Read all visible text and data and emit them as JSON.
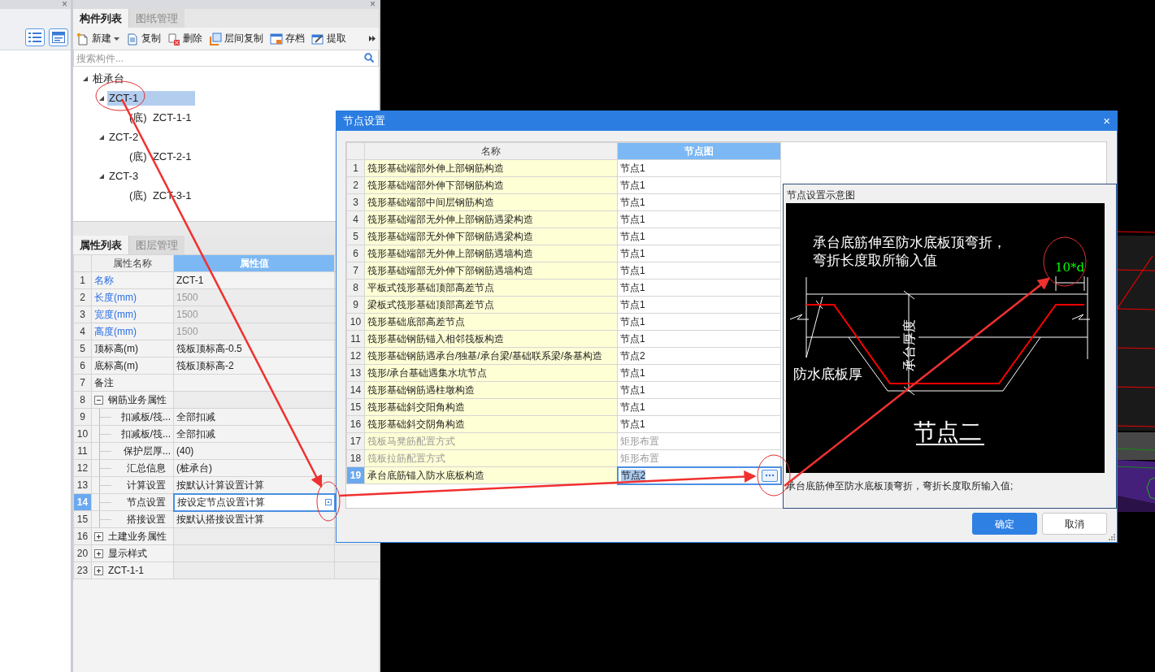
{
  "left_panel": {
    "close": "×"
  },
  "component_panel": {
    "close": "×",
    "tabs": [
      {
        "label": "构件列表",
        "selected": true
      },
      {
        "label": "图纸管理",
        "selected": false
      }
    ],
    "toolbar": [
      {
        "label": "新建",
        "kind": "new",
        "dropdown": true
      },
      {
        "label": "复制",
        "kind": "copy",
        "dropdown": false
      },
      {
        "label": "删除",
        "kind": "delete",
        "dropdown": false
      },
      {
        "label": "层间复制",
        "kind": "layers",
        "dropdown": false
      },
      {
        "label": "存档",
        "kind": "save",
        "dropdown": false
      },
      {
        "label": "提取",
        "kind": "extract",
        "dropdown": false
      }
    ],
    "search": {
      "placeholder": "搜索构件..."
    },
    "tree": [
      {
        "label": "桩承台",
        "expanded": true,
        "selected": false,
        "children": [
          {
            "label": "ZCT-1",
            "expanded": true,
            "selected": true,
            "children": [
              {
                "label": "(底)  ZCT-1-1",
                "selected": false
              }
            ]
          },
          {
            "label": "ZCT-2",
            "expanded": true,
            "selected": false,
            "children": [
              {
                "label": "(底)  ZCT-2-1",
                "selected": false
              }
            ]
          },
          {
            "label": "ZCT-3",
            "expanded": true,
            "selected": false,
            "children": [
              {
                "label": "(底)  ZCT-3-1",
                "selected": false
              }
            ]
          }
        ]
      }
    ]
  },
  "property_panel": {
    "tabs": [
      {
        "label": "属性列表",
        "selected": true
      },
      {
        "label": "图层管理",
        "selected": false
      }
    ],
    "columns": [
      "属性名称",
      "属性值"
    ],
    "rows": [
      {
        "kind": "field",
        "num": "1",
        "name": "名称",
        "value": "ZCT-1",
        "public": true,
        "disabled": false,
        "selected": false
      },
      {
        "kind": "field",
        "num": "2",
        "name": "长度(mm)",
        "value": "1500",
        "public": true,
        "disabled": true,
        "selected": false
      },
      {
        "kind": "field",
        "num": "3",
        "name": "宽度(mm)",
        "value": "1500",
        "public": true,
        "disabled": true,
        "selected": false
      },
      {
        "kind": "field",
        "num": "4",
        "name": "高度(mm)",
        "value": "1500",
        "public": true,
        "disabled": true,
        "selected": false
      },
      {
        "kind": "field",
        "num": "5",
        "name": "顶标高(m)",
        "value": "筏板顶标高-0.5",
        "public": false,
        "disabled": false,
        "selected": false
      },
      {
        "kind": "field",
        "num": "6",
        "name": "底标高(m)",
        "value": "筏板顶标高-2",
        "public": false,
        "disabled": false,
        "selected": false
      },
      {
        "kind": "field",
        "num": "7",
        "name": "备注",
        "public": false,
        "selected": false
      },
      {
        "kind": "group",
        "num": "8",
        "name": "钢筋业务属性",
        "expanded": true,
        "children": [
          {
            "kind": "field",
            "num": "9",
            "name": "扣减板/筏...",
            "value": "全部扣减",
            "public": false,
            "disabled": false,
            "selected": false
          },
          {
            "kind": "field",
            "num": "10",
            "name": "扣减板/筏...",
            "value": "全部扣减",
            "public": false,
            "disabled": false,
            "selected": false
          },
          {
            "kind": "field",
            "num": "11",
            "name": "保护层厚...",
            "value": "(40)",
            "public": false,
            "disabled": false,
            "selected": false
          },
          {
            "kind": "field",
            "num": "12",
            "name": "汇总信息",
            "value": "(桩承台)",
            "public": false,
            "disabled": false,
            "selected": false
          },
          {
            "kind": "field",
            "num": "13",
            "name": "计算设置",
            "value": "按默认计算设置计算",
            "public": false,
            "disabled": false,
            "selected": false
          },
          {
            "kind": "field",
            "num": "14",
            "name": "节点设置",
            "value": "按设定节点设置计算",
            "public": false,
            "disabled": false,
            "selected": true
          },
          {
            "kind": "field",
            "num": "15",
            "name": "搭接设置",
            "value": "按默认搭接设置计算",
            "public": false,
            "disabled": false,
            "selected": false
          }
        ]
      },
      {
        "kind": "group",
        "num": "16",
        "name": "土建业务属性",
        "expanded": false
      },
      {
        "kind": "group",
        "num": "20",
        "name": "显示样式",
        "expanded": false
      },
      {
        "kind": "group",
        "num": "23",
        "name": "ZCT-1-1",
        "expanded": false
      }
    ]
  },
  "dialog": {
    "title": "节点设置",
    "close": "×",
    "columns": [
      "名称",
      "节点图"
    ],
    "rows": [
      {
        "num": "1",
        "name": "筏形基础端部外伸上部钢筋构造",
        "value": "节点1",
        "disabled": false,
        "selected": false
      },
      {
        "num": "2",
        "name": "筏形基础端部外伸下部钢筋构造",
        "value": "节点1",
        "disabled": false,
        "selected": false
      },
      {
        "num": "3",
        "name": "筏形基础端部中间层钢筋构造",
        "value": "节点1",
        "disabled": false,
        "selected": false
      },
      {
        "num": "4",
        "name": "筏形基础端部无外伸上部钢筋遇梁构造",
        "value": "节点1",
        "disabled": false,
        "selected": false
      },
      {
        "num": "5",
        "name": "筏形基础端部无外伸下部钢筋遇梁构造",
        "value": "节点1",
        "disabled": false,
        "selected": false
      },
      {
        "num": "6",
        "name": "筏形基础端部无外伸上部钢筋遇墙构造",
        "value": "节点1",
        "disabled": false,
        "selected": false
      },
      {
        "num": "7",
        "name": "筏形基础端部无外伸下部钢筋遇墙构造",
        "value": "节点1",
        "disabled": false,
        "selected": false
      },
      {
        "num": "8",
        "name": "平板式筏形基础顶部高差节点",
        "value": "节点1",
        "disabled": false,
        "selected": false
      },
      {
        "num": "9",
        "name": "梁板式筏形基础顶部高差节点",
        "value": "节点1",
        "disabled": false,
        "selected": false
      },
      {
        "num": "10",
        "name": "筏形基础底部高差节点",
        "value": "节点1",
        "disabled": false,
        "selected": false
      },
      {
        "num": "11",
        "name": "筏形基础钢筋锚入相邻筏板构造",
        "value": "节点1",
        "disabled": false,
        "selected": false
      },
      {
        "num": "12",
        "name": "筏形基础钢筋遇承台/独基/承台梁/基础联系梁/条基构造",
        "value": "节点2",
        "disabled": false,
        "selected": false
      },
      {
        "num": "13",
        "name": "筏形/承台基础遇集水坑节点",
        "value": "节点1",
        "disabled": false,
        "selected": false
      },
      {
        "num": "14",
        "name": "筏形基础钢筋遇柱墩构造",
        "value": "节点1",
        "disabled": false,
        "selected": false
      },
      {
        "num": "15",
        "name": "筏形基础斜交阳角构造",
        "value": "节点1",
        "disabled": false,
        "selected": false
      },
      {
        "num": "16",
        "name": "筏形基础斜交阴角构造",
        "value": "节点1",
        "disabled": false,
        "selected": false
      },
      {
        "num": "17",
        "name": "筏板马凳筋配置方式",
        "value": "矩形布置",
        "disabled": true,
        "selected": false
      },
      {
        "num": "18",
        "name": "筏板拉筋配置方式",
        "value": "矩形布置",
        "disabled": true,
        "selected": false
      },
      {
        "num": "19",
        "name": "承台底筋锚入防水底板构造",
        "value": "节点2",
        "disabled": false,
        "selected": true
      }
    ],
    "preview": {
      "title": "节点设置示意图",
      "diagram": {
        "note_lines": [
          "承台底筋伸至防水底板顶弯折，",
          "弯折长度取所输入值"
        ],
        "dimension": "10*d",
        "left_label": "防水底板厚",
        "vertical_label": "承台厚度",
        "node_title": "节点二"
      },
      "caption": "承台底筋伸至防水底板顶弯折，弯折长度取所输入值;"
    },
    "buttons": [
      {
        "label": "确定",
        "kind": "primary"
      },
      {
        "label": "取消",
        "kind": "secondary"
      }
    ]
  }
}
